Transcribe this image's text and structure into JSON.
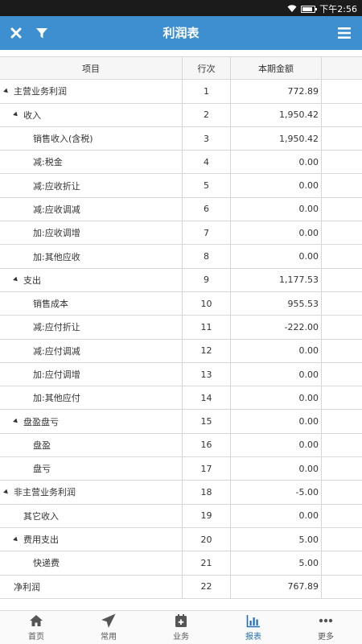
{
  "status_bar": {
    "time": "下午2:56"
  },
  "header": {
    "title": "利润表"
  },
  "table": {
    "columns": [
      "项目",
      "行次",
      "本期金额"
    ],
    "rows": [
      {
        "label": "主营业务利润",
        "level": 0,
        "expand": true,
        "line": "1",
        "amount": "772.89"
      },
      {
        "label": "收入",
        "level": 1,
        "expand": true,
        "line": "2",
        "amount": "1,950.42"
      },
      {
        "label": "销售收入(含税)",
        "level": 2,
        "expand": false,
        "line": "3",
        "amount": "1,950.42"
      },
      {
        "label": "减:税金",
        "level": 2,
        "expand": false,
        "line": "4",
        "amount": "0.00"
      },
      {
        "label": "减:应收折让",
        "level": 2,
        "expand": false,
        "line": "5",
        "amount": "0.00"
      },
      {
        "label": "减:应收调减",
        "level": 2,
        "expand": false,
        "line": "6",
        "amount": "0.00"
      },
      {
        "label": "加:应收调增",
        "level": 2,
        "expand": false,
        "line": "7",
        "amount": "0.00"
      },
      {
        "label": "加:其他应收",
        "level": 2,
        "expand": false,
        "line": "8",
        "amount": "0.00"
      },
      {
        "label": "支出",
        "level": 1,
        "expand": true,
        "line": "9",
        "amount": "1,177.53"
      },
      {
        "label": "销售成本",
        "level": 2,
        "expand": false,
        "line": "10",
        "amount": "955.53"
      },
      {
        "label": "减:应付折让",
        "level": 2,
        "expand": false,
        "line": "11",
        "amount": "-222.00"
      },
      {
        "label": "减:应付调减",
        "level": 2,
        "expand": false,
        "line": "12",
        "amount": "0.00"
      },
      {
        "label": "加:应付调增",
        "level": 2,
        "expand": false,
        "line": "13",
        "amount": "0.00"
      },
      {
        "label": "加:其他应付",
        "level": 2,
        "expand": false,
        "line": "14",
        "amount": "0.00"
      },
      {
        "label": "盘盈盘亏",
        "level": 1,
        "expand": true,
        "line": "15",
        "amount": "0.00"
      },
      {
        "label": "盘盈",
        "level": 2,
        "expand": false,
        "line": "16",
        "amount": "0.00"
      },
      {
        "label": "盘亏",
        "level": 2,
        "expand": false,
        "line": "17",
        "amount": "0.00"
      },
      {
        "label": "非主营业务利润",
        "level": 0,
        "expand": true,
        "line": "18",
        "amount": "-5.00"
      },
      {
        "label": "其它收入",
        "level": 1,
        "expand": false,
        "line": "19",
        "amount": "0.00"
      },
      {
        "label": "费用支出",
        "level": 1,
        "expand": true,
        "line": "20",
        "amount": "5.00"
      },
      {
        "label": "快递费",
        "level": 2,
        "expand": false,
        "line": "21",
        "amount": "5.00"
      },
      {
        "label": "净利润",
        "level": 0,
        "expand": false,
        "line": "22",
        "amount": "767.89"
      }
    ]
  },
  "tabbar": {
    "items": [
      {
        "label": "首页",
        "icon": "home-icon",
        "active": false
      },
      {
        "label": "常用",
        "icon": "send-icon",
        "active": false
      },
      {
        "label": "业务",
        "icon": "calendar-plus-icon",
        "active": false
      },
      {
        "label": "报表",
        "icon": "bar-chart-icon",
        "active": true
      },
      {
        "label": "更多",
        "icon": "more-icon",
        "active": false
      }
    ]
  },
  "colors": {
    "header_bg": "#3d8fd0",
    "tab_active": "#1f6fb3"
  }
}
